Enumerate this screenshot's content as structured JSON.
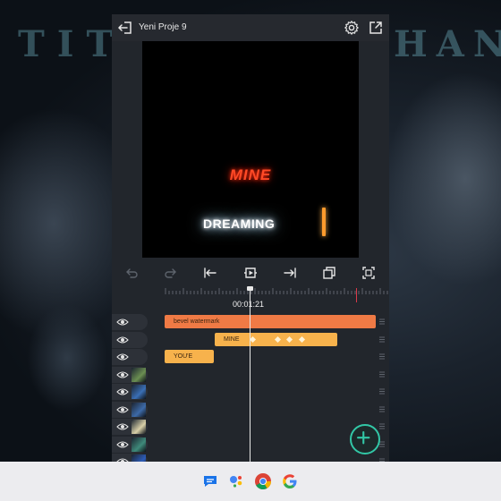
{
  "window": {
    "title": "Yeni Proje 9"
  },
  "wallpaper": {
    "left_text": "TIT",
    "right_text": "HAN"
  },
  "preview": {
    "mine_text": "MINE",
    "dreaming_text": "DREAMING",
    "mine_color": "#ff4a26",
    "dreaming_color": "#ffffff"
  },
  "toolbar": {
    "icons": [
      "undo-icon",
      "redo-icon",
      "jump-start-icon",
      "play-icon",
      "jump-end-icon",
      "duplicate-icon",
      "fullscreen-icon"
    ]
  },
  "timeline": {
    "current_time": "00:01:21",
    "tracks": [
      {
        "kind": "text",
        "clip_label": "bevel watermark",
        "clip_color": "#ef7a45"
      },
      {
        "kind": "text",
        "clip_label": "MINE",
        "clip_color": "#f7b24c"
      },
      {
        "kind": "text",
        "clip_label": "YOU'E",
        "clip_color": "#f7b24c"
      },
      {
        "kind": "image",
        "thumb_color": "#6b8f52"
      },
      {
        "kind": "image",
        "thumb_color": "#3a6fb5"
      },
      {
        "kind": "image",
        "thumb_color": "#3d6aa8"
      },
      {
        "kind": "image",
        "thumb_color": "#d9d0a8"
      },
      {
        "kind": "image",
        "thumb_color": "#3f8a7a"
      },
      {
        "kind": "image",
        "thumb_color": "#2d5cb8"
      }
    ]
  },
  "colors": {
    "accent": "#32c7a6",
    "playhead_end": "#d93a4a"
  },
  "taskbar": {
    "apps": [
      "messages-icon",
      "assistant-icon",
      "chrome-icon",
      "google-icon"
    ]
  }
}
